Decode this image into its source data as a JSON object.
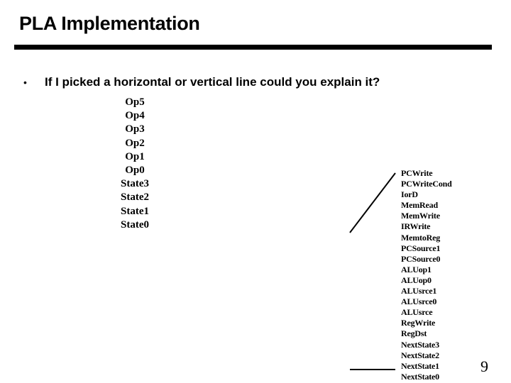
{
  "slide": {
    "title": "PLA Implementation",
    "bullet_marker": "•",
    "bullet_text": "If I picked a horizontal or vertical line could you explain it?",
    "page_number": "9"
  },
  "diagram": {
    "inputs": [
      "Op5",
      "Op4",
      "Op3",
      "Op2",
      "Op1",
      "Op0",
      "State3",
      "State2",
      "State1",
      "State0"
    ],
    "outputs": [
      "PCWrite",
      "PCWriteCond",
      "IorD",
      "MemRead",
      "MemWrite",
      "IRWrite",
      "MemtoReg",
      "PCSource1",
      "PCSource0",
      "ALUop1",
      "ALUop0",
      "ALUsrce1",
      "ALUsrce0",
      "ALUsrce",
      "RegWrite",
      "RegDst",
      "NextState3",
      "NextState2",
      "NextState1",
      "NextState0"
    ],
    "line_color": "#000000"
  }
}
